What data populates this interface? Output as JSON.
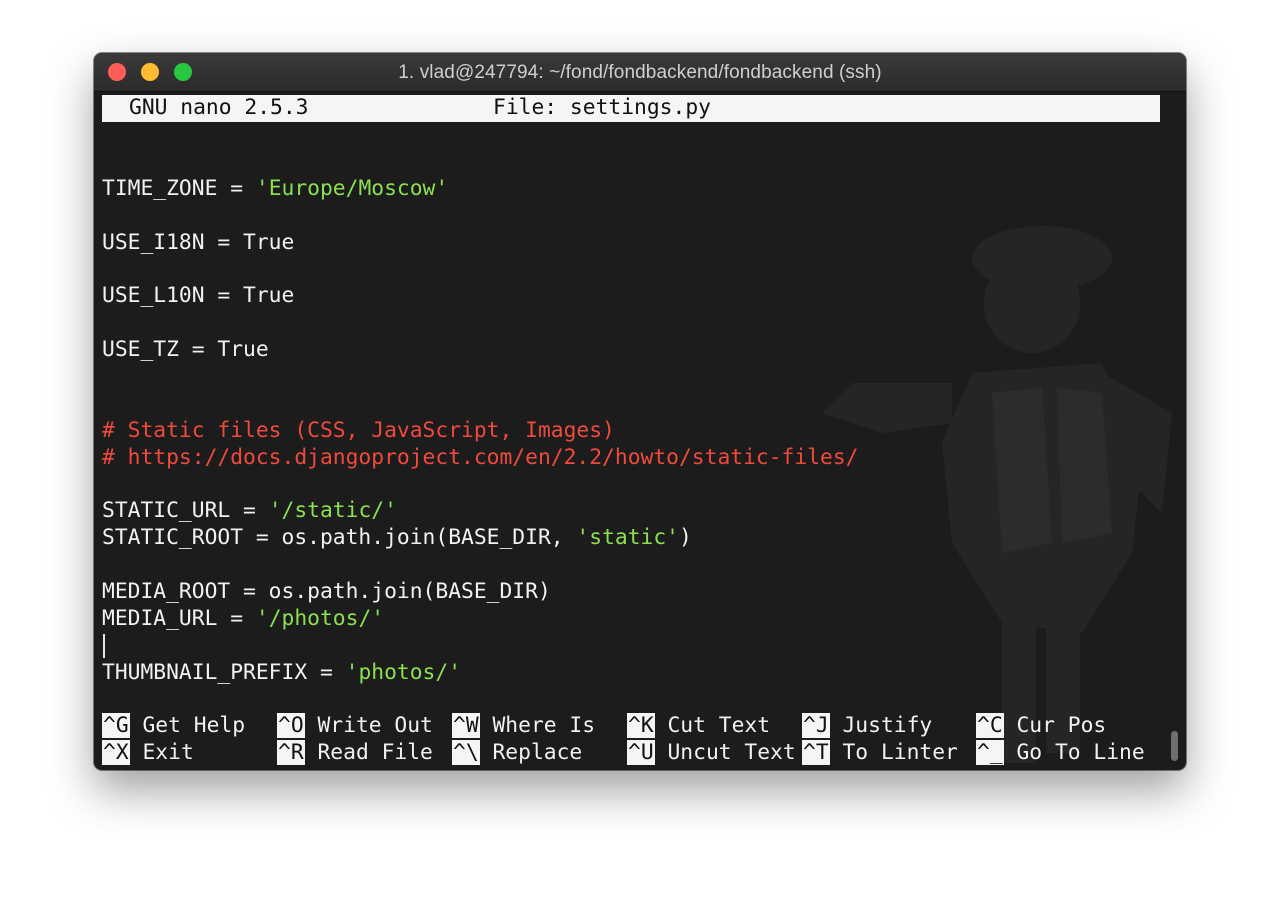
{
  "window": {
    "title": "1. vlad@247794: ~/fond/fondbackend/fondbackend (ssh)"
  },
  "nano": {
    "version": "GNU nano 2.5.3",
    "file_label": "File: settings.py"
  },
  "code": {
    "time_zone": {
      "prefix": "TIME_ZONE = ",
      "str": "'Europe/Moscow'"
    },
    "use_i18n": "USE_I18N = True",
    "use_l10n": "USE_L10N = True",
    "use_tz": "USE_TZ = True",
    "comment1": "# Static files (CSS, JavaScript, Images)",
    "comment2": "# https://docs.djangoproject.com/en/2.2/howto/static-files/",
    "static_url": {
      "prefix": "STATIC_URL = ",
      "str": "'/static/'"
    },
    "static_root": {
      "prefix": "STATIC_ROOT = os.path.join(BASE_DIR, ",
      "str": "'static'",
      "suffix": ")"
    },
    "media_root": "MEDIA_ROOT = os.path.join(BASE_DIR)",
    "media_url": {
      "prefix": "MEDIA_URL = ",
      "str": "'/photos/'"
    },
    "thumbnail_prefix": {
      "prefix": "THUMBNAIL_PREFIX = ",
      "str": "'photos/'"
    }
  },
  "shortcuts": {
    "row1": [
      {
        "key": "^G",
        "label": "Get Help"
      },
      {
        "key": "^O",
        "label": "Write Out"
      },
      {
        "key": "^W",
        "label": "Where Is"
      },
      {
        "key": "^K",
        "label": "Cut Text"
      },
      {
        "key": "^J",
        "label": "Justify"
      },
      {
        "key": "^C",
        "label": "Cur Pos"
      }
    ],
    "row2": [
      {
        "key": "^X",
        "label": "Exit"
      },
      {
        "key": "^R",
        "label": "Read File"
      },
      {
        "key": "^\\",
        "label": "Replace"
      },
      {
        "key": "^U",
        "label": "Uncut Text"
      },
      {
        "key": "^T",
        "label": "To Linter"
      },
      {
        "key": "^_",
        "label": "Go To Line"
      }
    ]
  },
  "colors": {
    "string": "#8be04f",
    "comment": "#ef4a3c",
    "background": "#1c1c1c"
  }
}
